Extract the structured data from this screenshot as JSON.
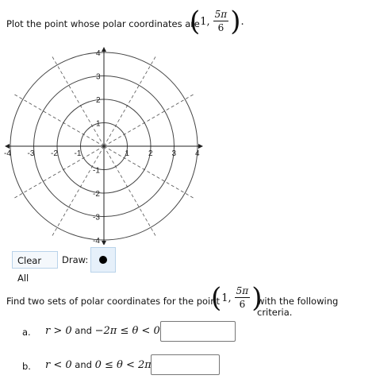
{
  "question1": {
    "prompt": "Plot the point whose polar coordinates are",
    "r": "1,",
    "theta_num": "5π",
    "theta_den": "6",
    "end": "."
  },
  "graph": {
    "ring_labels": [
      "1",
      "2",
      "3",
      "4"
    ],
    "axis_labels": {
      "x_pos": [
        "1",
        "2",
        "3",
        "4"
      ],
      "x_neg": [
        "-1",
        "-2",
        "-3",
        "-4"
      ],
      "y_pos": [
        "1",
        "2",
        "3",
        "4"
      ],
      "y_neg": [
        "-1",
        "-2",
        "-3",
        "-4"
      ]
    }
  },
  "controls": {
    "clear_all": "Clear All",
    "draw_label": "Draw:"
  },
  "question2": {
    "prompt": "Find two sets of polar coordinates for the point",
    "r": "1,",
    "theta_num": "5π",
    "theta_den": "6",
    "suffix": "with the following criteria."
  },
  "criteria": [
    {
      "letter": "a.",
      "r_cond": "r > 0",
      "and": " and ",
      "theta_cond": "−2π ≤ θ < 0:",
      "answer": ""
    },
    {
      "letter": "b.",
      "r_cond": "r < 0",
      "and": " and ",
      "theta_cond": "0 ≤ θ < 2π:",
      "answer": ""
    }
  ]
}
